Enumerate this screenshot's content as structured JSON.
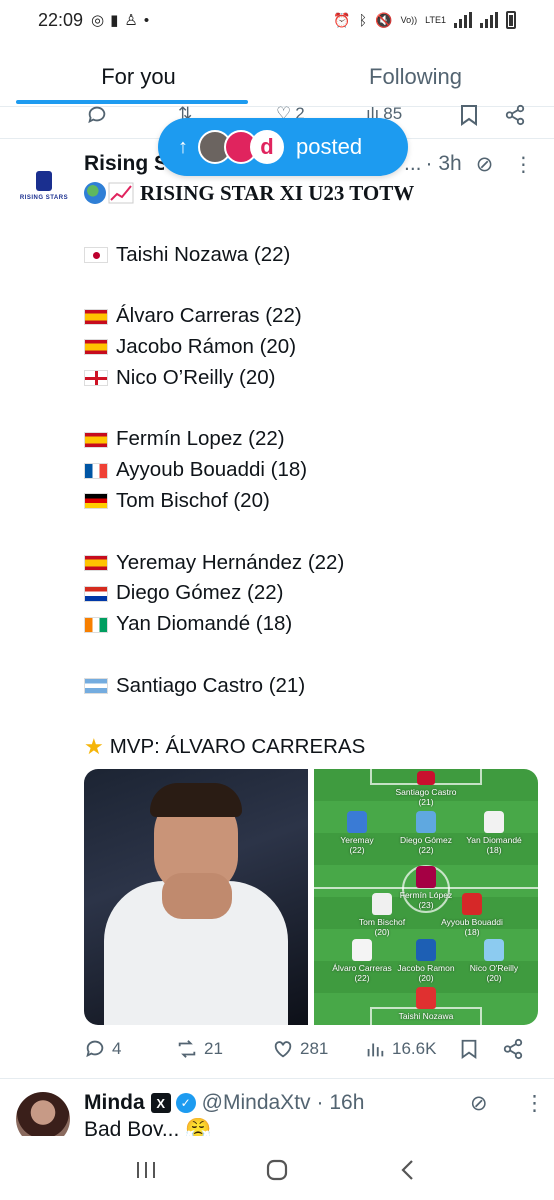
{
  "status_bar": {
    "time": "22:09",
    "network": "LTE1",
    "volte": "Vo))"
  },
  "tabs": [
    {
      "label": "For you",
      "active": true
    },
    {
      "label": "Following",
      "active": false
    }
  ],
  "prev_post_actions": {
    "likes": "2",
    "views": "85"
  },
  "posted_pill": {
    "label": "posted"
  },
  "post": {
    "author_name": "Rising S",
    "author_truncation": "...",
    "time": "· 3h",
    "avatar_logo_text": "RISING STARS",
    "title": "RISING STAR XI U23 TOTW",
    "lines": [
      {
        "flag": "jp",
        "text": "Taishi Nozawa (22)"
      },
      {
        "flag": "es",
        "text": "Álvaro Carreras (22)"
      },
      {
        "flag": "es",
        "text": "Jacobo Rámon (20)"
      },
      {
        "flag": "en",
        "text": "Nico O’Reilly (20)"
      },
      {
        "flag": "es",
        "text": "Fermín Lopez (22)"
      },
      {
        "flag": "fr",
        "text": "Ayyoub Bouaddi (18)"
      },
      {
        "flag": "de",
        "text": "Tom Bischof (20)"
      },
      {
        "flag": "es",
        "text": "Yeremay Hernández (22)"
      },
      {
        "flag": "py",
        "text": "Diego Gómez (22)"
      },
      {
        "flag": "ci",
        "text": "Yan Diomandé (18)"
      },
      {
        "flag": "ar",
        "text": "Santiago Castro (21)"
      }
    ],
    "mvp": "MVP: ÁLVARO CARRERAS",
    "lineup": [
      {
        "name": "Santiago Castro",
        "age": "(21)",
        "shirt": "#c8102e"
      },
      {
        "name": "Yeremay",
        "age": "(22)",
        "shirt": "#3a7bd5"
      },
      {
        "name": "Diego Gómez",
        "age": "(22)",
        "shirt": "#5fa8e0"
      },
      {
        "name": "Yan Diomandé",
        "age": "(18)",
        "shirt": "#f2f2f2"
      },
      {
        "name": "Fermín López",
        "age": "(23)",
        "shirt": "#a50044"
      },
      {
        "name": "Tom Bischof",
        "age": "(20)",
        "shirt": "#f0f0f0"
      },
      {
        "name": "Ayyoub Bouaddi",
        "age": "(18)",
        "shirt": "#d62828"
      },
      {
        "name": "Álvaro Carreras",
        "age": "(22)",
        "shirt": "#f4f4f4"
      },
      {
        "name": "Jacobo Ramon",
        "age": "(20)",
        "shirt": "#1d5fb4"
      },
      {
        "name": "Nico O'Reilly",
        "age": "(20)",
        "shirt": "#8ccbf0"
      },
      {
        "name": "Taishi Nozawa",
        "age": "",
        "shirt": "#e03030"
      }
    ],
    "actions": {
      "replies": "4",
      "reposts": "21",
      "likes": "281",
      "views": "16.6K"
    }
  },
  "next_post": {
    "author_name": "Minda",
    "handle": "@MindaXtv",
    "time": "· 16h",
    "text": "Bad Boy... 😤"
  },
  "colors": {
    "accent": "#1d9bf0",
    "secondary_text": "#536471",
    "divider": "#e6ecf0"
  }
}
